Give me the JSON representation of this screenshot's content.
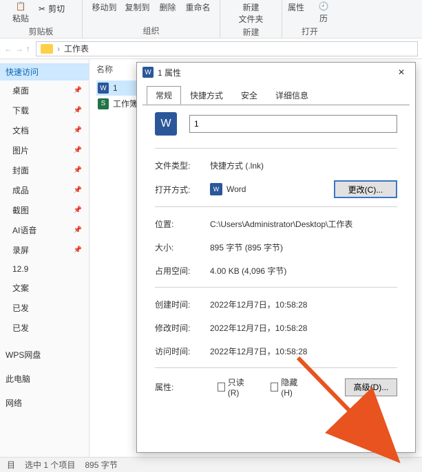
{
  "ribbon": {
    "paste": "粘贴",
    "cut": "剪切",
    "clipboard_caption": "剪贴板",
    "moveto": "移动到",
    "copyto": "复制到",
    "delete": "删除",
    "rename": "重命名",
    "organize_caption": "组织",
    "newfolder": "新建\n文件夹",
    "new_caption": "新建",
    "properties": "属性",
    "history": "历",
    "open_caption": "打开"
  },
  "nav": {
    "up": "↑"
  },
  "breadcrumb": {
    "folder": "工作表"
  },
  "sidebar": {
    "quick": "快速访问",
    "items": [
      {
        "label": "桌面"
      },
      {
        "label": "下载"
      },
      {
        "label": "文档"
      },
      {
        "label": "图片"
      },
      {
        "label": "封面"
      },
      {
        "label": "成品"
      },
      {
        "label": "截图"
      },
      {
        "label": "AI语音"
      },
      {
        "label": "录屏"
      },
      {
        "label": "12.9"
      },
      {
        "label": "文案"
      },
      {
        "label": "已发"
      },
      {
        "label": "已发"
      }
    ],
    "extras": [
      {
        "label": "WPS网盘"
      },
      {
        "label": "此电脑"
      },
      {
        "label": "网络"
      }
    ]
  },
  "main": {
    "col_name": "名称",
    "files": [
      {
        "icon": "doc",
        "name": "1",
        "selected": true
      },
      {
        "icon": "xls",
        "name": "工作簿1",
        "selected": false
      }
    ]
  },
  "dialog": {
    "title": "1 属性",
    "tabs": {
      "general": "常规",
      "shortcut": "快捷方式",
      "security": "安全",
      "details": "详细信息"
    },
    "name_value": "1",
    "rows": {
      "filetype_l": "文件类型:",
      "filetype_v": "快捷方式 (.lnk)",
      "openwith_l": "打开方式:",
      "openwith_v": "Word",
      "change_btn": "更改(C)...",
      "location_l": "位置:",
      "location_v": "C:\\Users\\Administrator\\Desktop\\工作表",
      "size_l": "大小:",
      "size_v": "895 字节 (895 字节)",
      "disk_l": "占用空间:",
      "disk_v": "4.00 KB (4,096 字节)",
      "created_l": "创建时间:",
      "created_v": "2022年12月7日，10:58:28",
      "modified_l": "修改时间:",
      "modified_v": "2022年12月7日，10:58:28",
      "accessed_l": "访问时间:",
      "accessed_v": "2022年12月7日，10:58:28",
      "attr_l": "属性:",
      "readonly": "只读(R)",
      "hidden": "隐藏(H)",
      "advanced_btn": "高级(D)..."
    }
  },
  "status": {
    "count_label": "目",
    "selected": "选中 1 个项目",
    "size": "895 字节"
  }
}
